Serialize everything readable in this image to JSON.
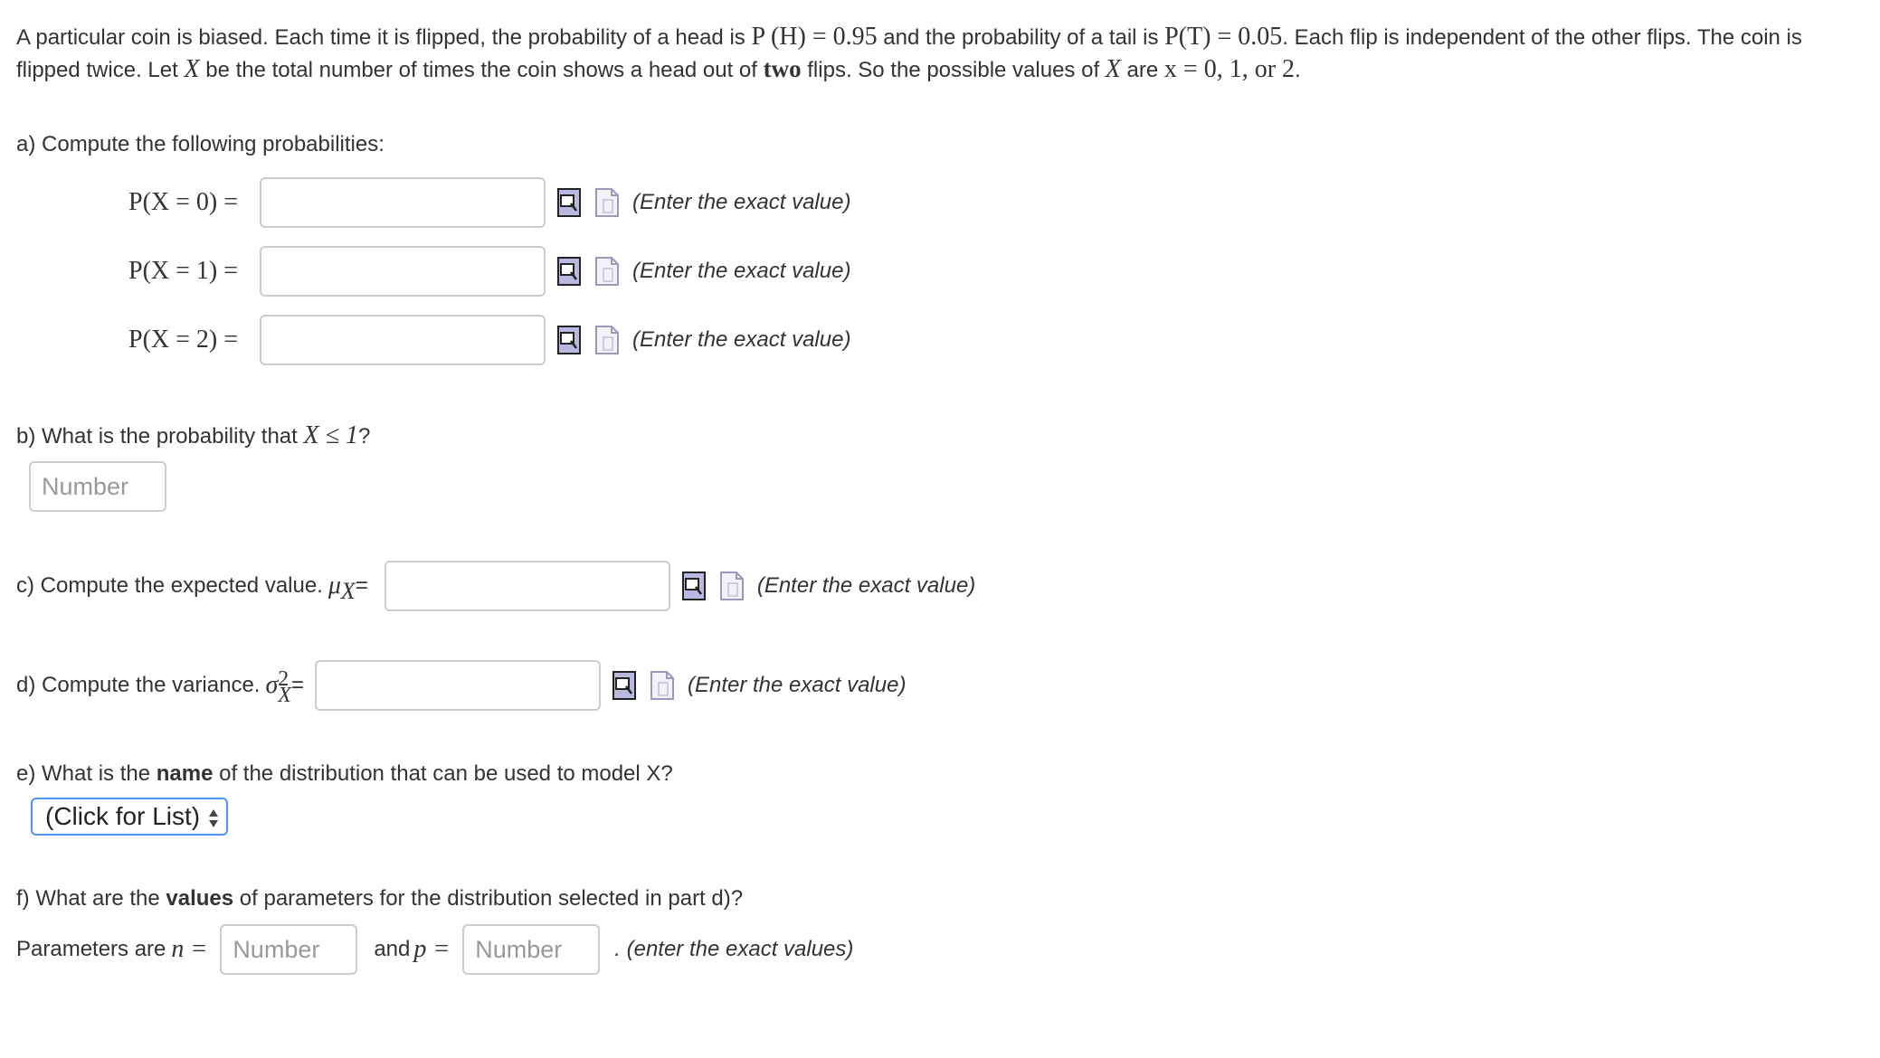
{
  "intro": {
    "p1": "A particular coin is biased. Each time it is flipped, the probability of a head is ",
    "ph": "P (H) = 0.95",
    "p2": " and the probability of a tail is ",
    "pt": "P(T) = 0.05",
    "p3": ". Each flip is independent of the other flips. The coin is flipped twice.  Let ",
    "x1": "X",
    "p4": " be the total number of times the coin shows a head out of ",
    "two": "two",
    "p5": " flips. So the possible values of ",
    "x2": "X",
    "p6": " are ",
    "xv": "x = 0, 1, or 2",
    "p7": "."
  },
  "part_a": {
    "heading": "a) Compute the following probabilities:",
    "rows": [
      {
        "label": "P(X = 0) =",
        "hint": "(Enter the exact value)"
      },
      {
        "label": "P(X = 1) =",
        "hint": "(Enter the exact value)"
      },
      {
        "label": "P(X = 2) =",
        "hint": "(Enter the exact value)"
      }
    ]
  },
  "part_b": {
    "heading_text": "b) What is the probability that ",
    "heading_math": "X ≤ 1",
    "heading_end": "?",
    "placeholder": "Number"
  },
  "part_c": {
    "label_text": "c) Compute the expected value. ",
    "label_math": "μ",
    "label_sub": "X",
    "label_eq": "=",
    "hint": "(Enter the exact value)"
  },
  "part_d": {
    "label_text": "d) Compute the variance. ",
    "label_math": "σ",
    "label_sup": "2",
    "label_sub": "X",
    "label_eq": "=",
    "hint": "(Enter the exact value)"
  },
  "part_e": {
    "q_start": "e) What is the ",
    "q_bold": "name",
    "q_end": " of the distribution that can be used to model X?",
    "select_value": "(Click for List)"
  },
  "part_f": {
    "q_start": "f) What are the ",
    "q_bold": "values",
    "q_end": " of parameters for the distribution selected in part d)?",
    "params_label": "Parameters are ",
    "n_math": "n =",
    "n_placeholder": "Number",
    "and_label": "and ",
    "p_math": "p =",
    "p_placeholder": "Number",
    "hint": ". (enter the exact values)"
  },
  "colors": {
    "text": "#333333",
    "border": "#cccccc",
    "focus": "#4d90fe",
    "placeholder": "#999999"
  }
}
